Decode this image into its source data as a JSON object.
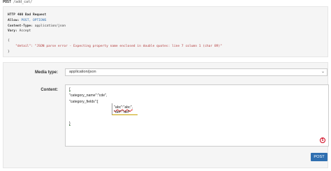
{
  "request": {
    "method": "POST",
    "path": "/add_cat/"
  },
  "response": {
    "status_line": "HTTP 400 Bad Request",
    "headers": [
      {
        "name": "Allow:",
        "value": "POST, OPTIONS"
      },
      {
        "name": "Content-Type:",
        "value": "application/json"
      },
      {
        "name": "Vary:",
        "value": "Accept"
      }
    ],
    "body_open": "{",
    "body_line": "\"detail\": \"JSON parse error - Expecting property name enclosed in double quotes: line 7 column 1 (char 89)\"",
    "body_close": "}"
  },
  "form": {
    "media_type_label": "Media type:",
    "media_type_value": "application/json",
    "content_label": "Content:",
    "content_lines": {
      "open": "{",
      "category_name": "\"category_name\":\"cde\",",
      "category_fields": "\"category_fields\":[",
      "field1": "\"abc\":\"abc\",",
      "field2": "\"def\":\"def\"",
      "inner_close": "],",
      "close": "}"
    },
    "grammar_badge": "5",
    "post_label": "POST"
  }
}
